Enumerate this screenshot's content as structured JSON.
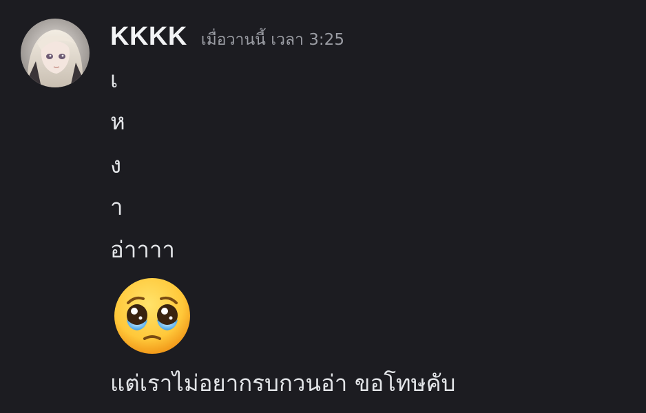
{
  "message": {
    "author": "KKKK",
    "timestamp": "เมื่อวานนี้ เวลา 3:25",
    "lines": [
      "เ",
      "ห",
      "ง",
      "า",
      "อ่าาาา"
    ],
    "emoji": "pleading-face-emoji",
    "final_line": "แต่เราไม่อยากรบกวนอ่า ขอโทษคับ"
  },
  "colors": {
    "background": "#1c1c21",
    "username": "#f2f3f5",
    "timestamp": "#9a9ca3",
    "message_text": "#e3e5e8"
  }
}
